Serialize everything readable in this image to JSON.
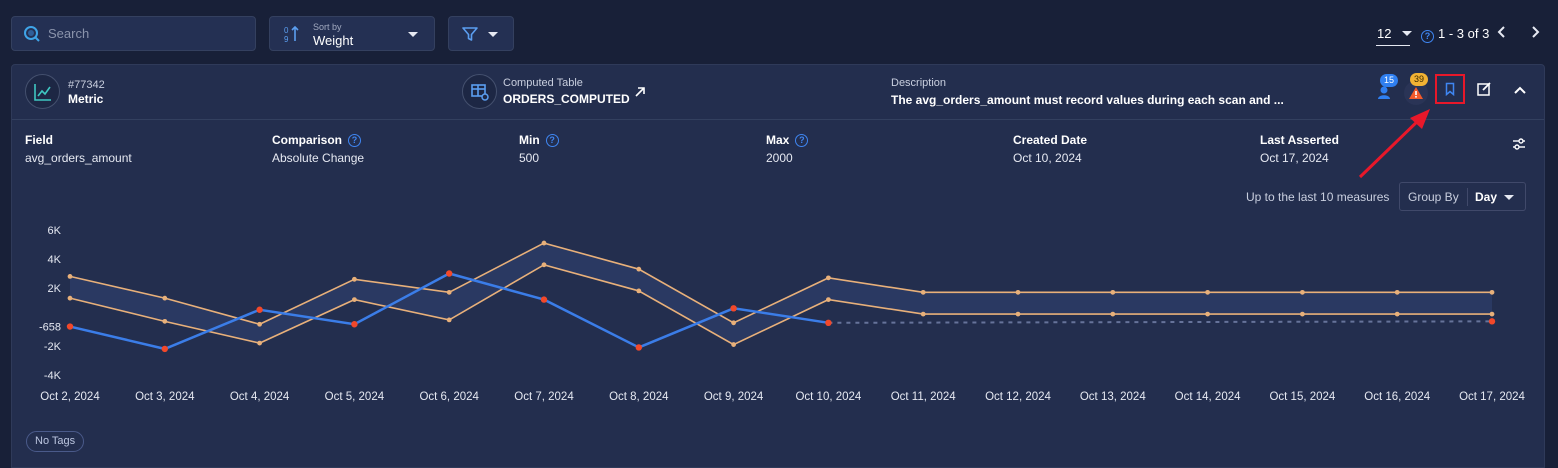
{
  "toolbar": {
    "search_placeholder": "Search",
    "sort_label": "Sort by",
    "sort_value": "Weight",
    "page_size": "12",
    "range": "1 - 3 of 3"
  },
  "card": {
    "id": "#77342",
    "type": "Metric",
    "table_label": "Computed Table",
    "table_value": "ORDERS_COMPUTED",
    "description_label": "Description",
    "description_value": "The avg_orders_amount must record values during each scan and ...",
    "assignees_count": "15",
    "anomalies_count": "39"
  },
  "fields": [
    {
      "label": "Field",
      "value": "avg_orders_amount",
      "help": false
    },
    {
      "label": "Comparison",
      "value": "Absolute Change",
      "help": true
    },
    {
      "label": "Min",
      "value": "500",
      "help": true
    },
    {
      "label": "Max",
      "value": "2000",
      "help": true
    },
    {
      "label": "Created Date",
      "value": "Oct 10, 2024",
      "help": false
    },
    {
      "label": "Last Asserted",
      "value": "Oct 17, 2024",
      "help": false
    }
  ],
  "controls": {
    "measures_text": "Up to the last 10 measures",
    "group_by_label": "Group By",
    "group_by_value": "Day"
  },
  "tags": {
    "label": "No Tags"
  },
  "chart_data": {
    "type": "line",
    "x": [
      "Oct 2, 2024",
      "Oct 3, 2024",
      "Oct 4, 2024",
      "Oct 5, 2024",
      "Oct 6, 2024",
      "Oct 7, 2024",
      "Oct 8, 2024",
      "Oct 9, 2024",
      "Oct 10, 2024",
      "Oct 11, 2024",
      "Oct 12, 2024",
      "Oct 13, 2024",
      "Oct 14, 2024",
      "Oct 15, 2024",
      "Oct 16, 2024",
      "Oct 17, 2024"
    ],
    "y_ticks": [
      "6K",
      "4K",
      "2K",
      "-658",
      "-2K",
      "-4K"
    ],
    "y_tick_values": [
      6000,
      4000,
      2000,
      -658,
      -2000,
      -4000
    ],
    "ylim": [
      -4000,
      6000
    ],
    "series": [
      {
        "role": "upper_bound",
        "values": [
          2800,
          1300,
          -500,
          2600,
          1700,
          5100,
          3300,
          -400,
          2700,
          1700,
          1700,
          1700,
          1700,
          1700,
          1700,
          1700
        ],
        "color": "#e8b07a"
      },
      {
        "role": "lower_bound",
        "values": [
          1300,
          -300,
          -1800,
          1200,
          -200,
          3600,
          1800,
          -1900,
          1200,
          200,
          200,
          200,
          200,
          200,
          200,
          200
        ],
        "color": "#e8b07a"
      },
      {
        "role": "actual",
        "values": [
          -658,
          -2200,
          500,
          -500,
          3000,
          1200,
          -2100,
          600,
          -400,
          null,
          null,
          null,
          null,
          null,
          null,
          null
        ],
        "color": "#3b7de8"
      }
    ],
    "projected": {
      "from_index": 8,
      "to_index": 15,
      "start": -400,
      "end": -300
    },
    "anomaly_indices": [
      0,
      1,
      2,
      3,
      4,
      5,
      6,
      7,
      8,
      15
    ]
  }
}
